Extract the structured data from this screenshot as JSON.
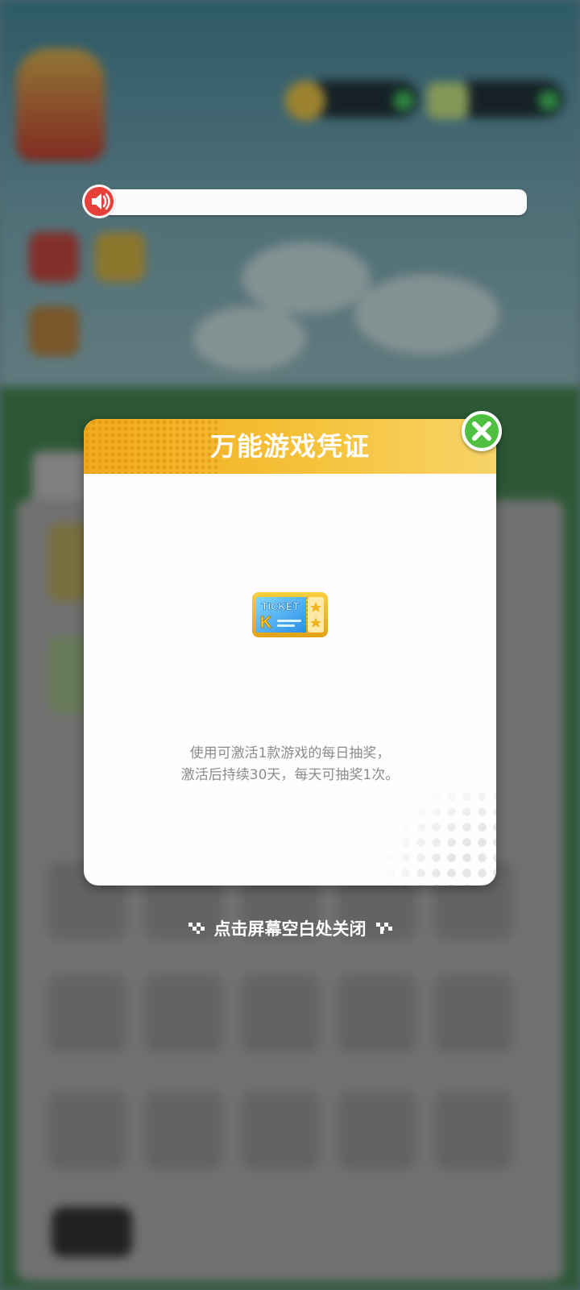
{
  "modal": {
    "title": "万能游戏凭证",
    "description_line1": "使用可激活1款游戏的每日抽奖，",
    "description_line2": "激活后持续30天，每天可抽奖1次。",
    "item_icon": "ticket-icon",
    "ticket_text": "TICKET",
    "ticket_letter": "K"
  },
  "close_hint": "点击屏幕空白处关闭",
  "colors": {
    "header_gradient_start": "#f1aa1c",
    "header_gradient_end": "#f7d468",
    "close_button": "#4fbf3f",
    "speaker": "#e7403a",
    "description_text": "#8c8c8c"
  }
}
